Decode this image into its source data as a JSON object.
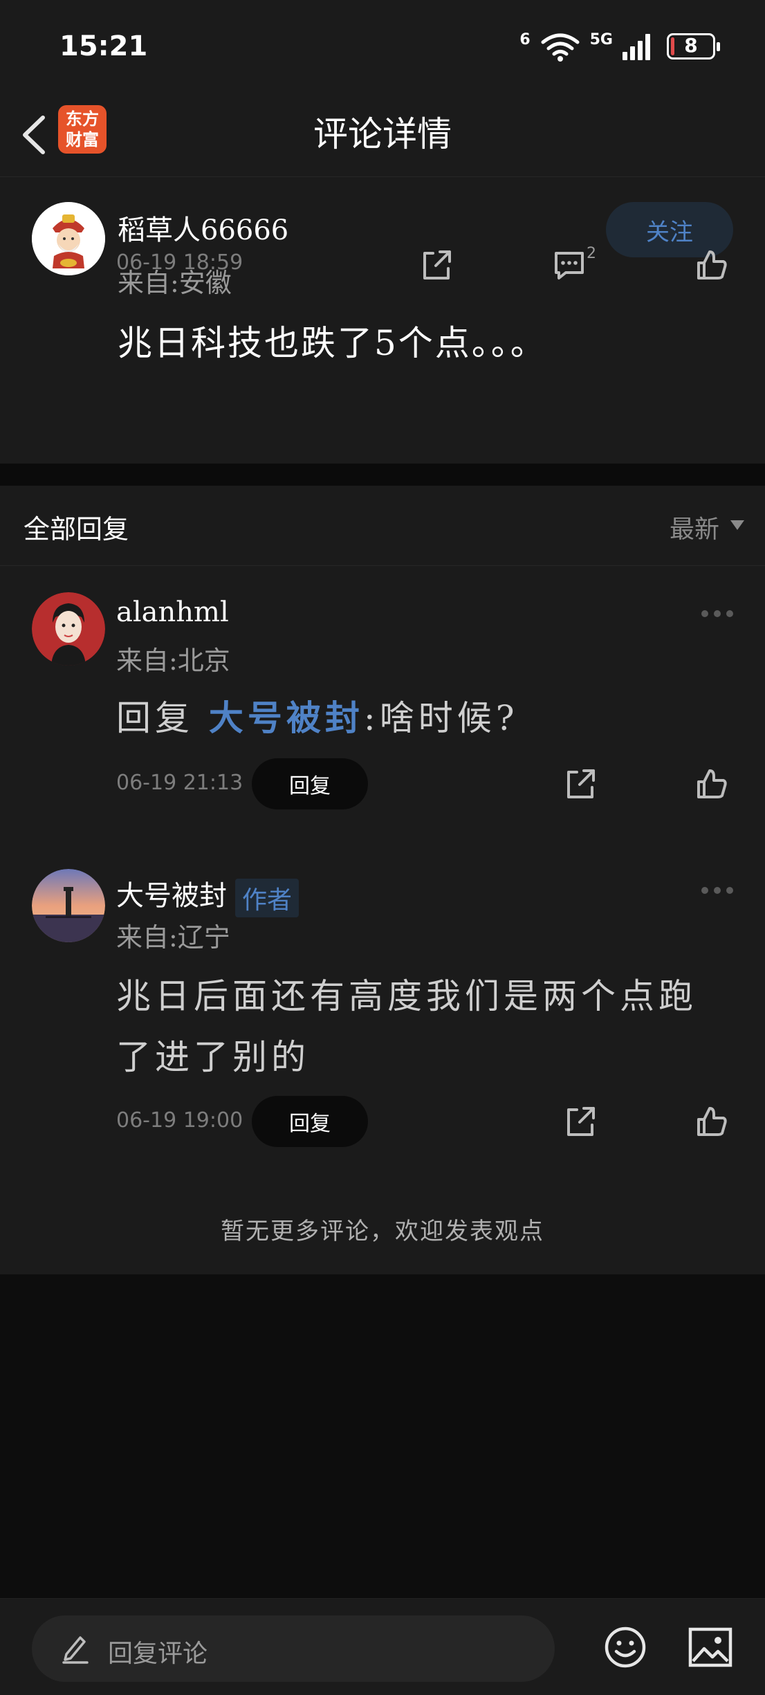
{
  "status_bar": {
    "time": "15:21",
    "network_label": "5G",
    "wifi_badge": "6",
    "battery_level": "8",
    "battery_percent": 8
  },
  "nav": {
    "title": "评论详情",
    "logo_line1": "东方",
    "logo_line2": "财富",
    "back_icon": "chevron-left-icon"
  },
  "main_comment": {
    "username": "稻草人66666",
    "location": "来自:安徽",
    "follow_label": "关注",
    "text": "兆日科技也跌了5个点。。。",
    "time": "06-19 18:59",
    "comment_count": "2",
    "icons": [
      "share-icon",
      "comment-icon",
      "like-icon"
    ]
  },
  "replies": {
    "title": "全部回复",
    "sort_label": "最新",
    "items": [
      {
        "username": "alanhml",
        "location": "来自:北京",
        "text_prefix": "回复 ",
        "mention": "大号被封",
        "text_suffix": ":啥时候?",
        "time": "06-19 21:13",
        "reply_label": "回复"
      },
      {
        "username": "大号被封",
        "badge": "作者",
        "location": "来自:辽宁",
        "text": "兆日后面还有高度我们是两个点跑了进了别的",
        "time": "06-19 19:00",
        "reply_label": "回复"
      }
    ],
    "no_more": "暂无更多评论，欢迎发表观点"
  },
  "bottom_bar": {
    "placeholder": "回复评论",
    "icons": [
      "pencil-icon",
      "emoji-icon",
      "image-icon"
    ]
  },
  "colors": {
    "background": "#1b1b1b",
    "accent": "#4f82c6",
    "logo": "#e6532a",
    "battery_low": "#e14b4b"
  }
}
